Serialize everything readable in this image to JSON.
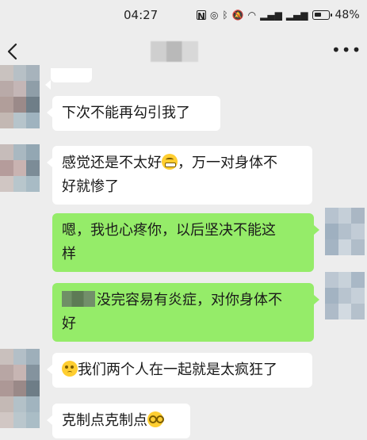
{
  "status_bar": {
    "time": "04:27",
    "icons": [
      "nfc-icon",
      "do-not-disturb-icon",
      "bluetooth-icon",
      "mute-icon",
      "wifi-icon",
      "signal-5g-icon",
      "signal-4g-icon",
      "battery-icon"
    ],
    "battery_percent": "48%"
  },
  "nav": {
    "back_icon": "chevron-left-icon",
    "more_icon": "more-dots-icon",
    "more_label": "•••"
  },
  "messages": [
    {
      "side": "in",
      "parts": [
        {
          "type": "text",
          "value": "下次不能再勾引我了"
        }
      ]
    },
    {
      "side": "in",
      "parts": [
        {
          "type": "text",
          "value": "感觉还是不太好"
        },
        {
          "type": "emoji",
          "name": "grimace"
        },
        {
          "type": "text",
          "value": "，万一对身体不"
        },
        {
          "type": "text",
          "value": "好就惨了"
        }
      ]
    },
    {
      "side": "out",
      "parts": [
        {
          "type": "text",
          "value": "嗯，我也心疼你，以后坚决不能这"
        },
        {
          "type": "text",
          "value": "样"
        }
      ]
    },
    {
      "side": "out",
      "parts": [
        {
          "type": "text",
          "value": "没完容易有炎症，对你身体不"
        },
        {
          "type": "text",
          "value": "好"
        }
      ]
    },
    {
      "side": "in",
      "parts": [
        {
          "type": "emoji",
          "name": "pleading"
        },
        {
          "type": "text",
          "value": "我们两个人在一起就是太疯狂了"
        }
      ]
    },
    {
      "side": "in",
      "parts": [
        {
          "type": "text",
          "value": "克制点克制点"
        },
        {
          "type": "emoji",
          "name": "dizzy"
        }
      ]
    }
  ],
  "colors": {
    "background": "#ededed",
    "incoming_bubble": "#ffffff",
    "outgoing_bubble": "#95ec69"
  }
}
